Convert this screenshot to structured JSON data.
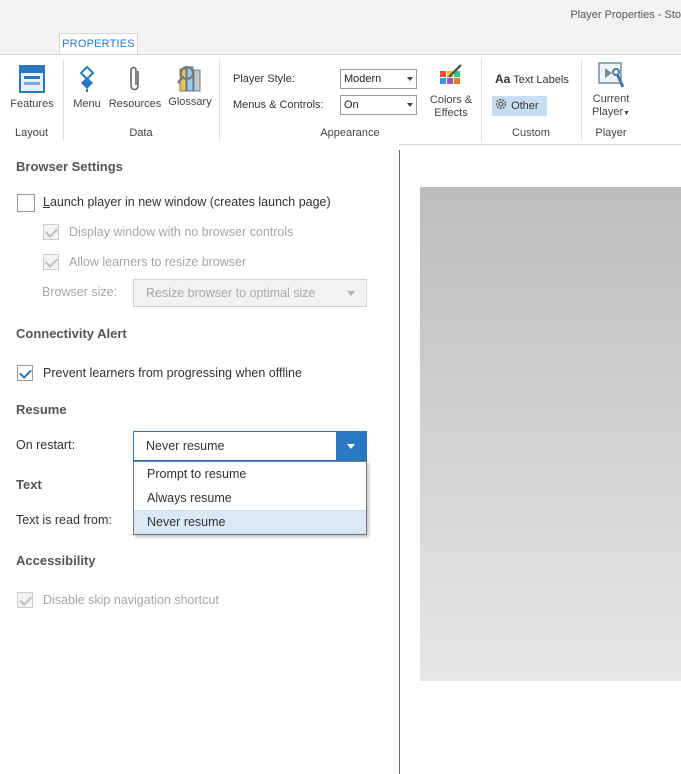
{
  "window": {
    "title": "Player Properties - Sto"
  },
  "ribbon": {
    "tab": "PROPERTIES",
    "groups": {
      "layout": "Layout",
      "data": "Data",
      "appearance": "Appearance",
      "custom": "Custom",
      "player": "Player"
    },
    "features": "Features",
    "menu": "Menu",
    "resources": "Resources",
    "glossary": "Glossary",
    "player_style_label": "Player Style:",
    "player_style_value": "Modern",
    "menus_controls_label": "Menus & Controls:",
    "menus_controls_value": "On",
    "colors_effects_line1": "Colors &",
    "colors_effects_line2": "Effects",
    "text_labels": "Text Labels",
    "text_labels_prefix": "Aa",
    "other": "Other",
    "current_player_line1": "Current",
    "current_player_line2": "Player"
  },
  "browser": {
    "heading": "Browser Settings",
    "launch_new_window": {
      "label": "Launch player in new window (creates launch page)",
      "checked": false
    },
    "no_browser_controls": {
      "label": "Display window with no browser controls",
      "checked": true,
      "disabled": true
    },
    "allow_resize": {
      "label": "Allow learners to resize browser",
      "checked": true,
      "disabled": true
    },
    "size_label": "Browser size:",
    "size_value": "Resize browser to optimal size"
  },
  "connectivity": {
    "heading": "Connectivity Alert",
    "prevent_offline": {
      "label": "Prevent learners from progressing when offline",
      "checked": true
    }
  },
  "resume": {
    "heading": "Resume",
    "on_restart_label": "On restart:",
    "value": "Never resume",
    "options": [
      "Prompt to resume",
      "Always resume",
      "Never resume"
    ]
  },
  "text": {
    "heading": "Text",
    "read_from_label": "Text is read from:"
  },
  "accessibility": {
    "heading": "Accessibility",
    "disable_skip_nav": {
      "label": "Disable skip navigation shortcut",
      "checked": true,
      "disabled": true
    }
  },
  "colors": {
    "accent": "#2b78c2",
    "selected_option_bg": "#dbe9f7",
    "other_button_bg": "#c6ddf2"
  }
}
